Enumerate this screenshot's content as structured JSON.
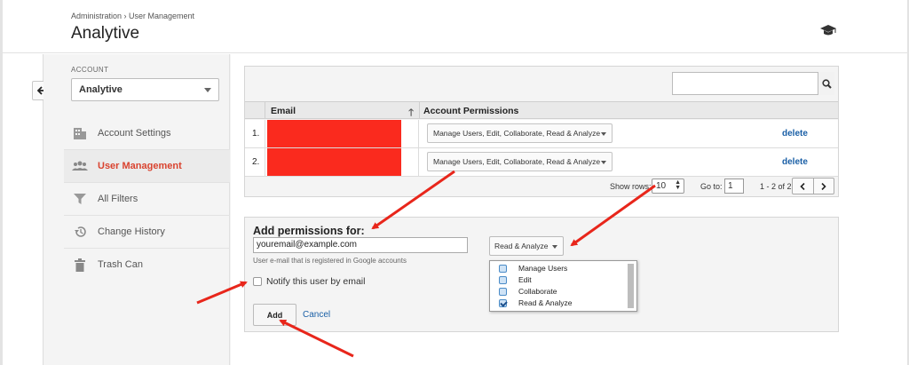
{
  "header": {
    "breadcrumb": "Administration › User Management",
    "title": "Analytive",
    "help_icon": "graduation-cap-icon"
  },
  "nav": {
    "account_label": "ACCOUNT",
    "account_value": "Analytive",
    "items": [
      {
        "label": "Account Settings",
        "icon": "building-icon",
        "active": false
      },
      {
        "label": "User Management",
        "icon": "users-icon",
        "active": true
      },
      {
        "label": "All Filters",
        "icon": "filter-icon",
        "active": false
      },
      {
        "label": "Change History",
        "icon": "history-icon",
        "active": false
      },
      {
        "label": "Trash Can",
        "icon": "trash-icon",
        "active": false
      }
    ]
  },
  "table": {
    "columns": [
      "Email",
      "Account Permissions"
    ],
    "rows": [
      {
        "num": "1.",
        "permission": "Manage Users, Edit, Collaborate, Read & Analyze",
        "action": "delete"
      },
      {
        "num": "2.",
        "permission": "Manage Users, Edit, Collaborate, Read & Analyze",
        "action": "delete"
      }
    ],
    "pager": {
      "show_rows_label": "Show rows:",
      "rows_value": "10",
      "goto_label": "Go to:",
      "goto_value": "1",
      "range": "1 - 2 of 2"
    }
  },
  "add": {
    "title": "Add permissions for:",
    "email_value": "youremail@example.com",
    "help": "User e-mail that is registered in Google accounts",
    "notify_label": "Notify this user by email",
    "role_value": "Read & Analyze",
    "role_options": [
      {
        "label": "Manage Users",
        "checked": false
      },
      {
        "label": "Edit",
        "checked": false
      },
      {
        "label": "Collaborate",
        "checked": false
      },
      {
        "label": "Read & Analyze",
        "checked": true
      }
    ],
    "add_label": "Add",
    "cancel_label": "Cancel"
  },
  "colors": {
    "active_nav": "#d9432f",
    "link": "#1a5fa6",
    "redaction": "#fa2a1e",
    "annotation_arrow": "#e8261b"
  }
}
